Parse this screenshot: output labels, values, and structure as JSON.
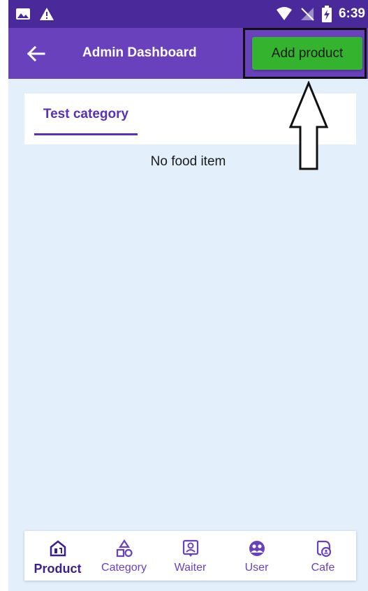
{
  "status_bar": {
    "time": "6:39",
    "icons": [
      "image-icon",
      "warning-icon",
      "wifi-icon",
      "no-sim-icon",
      "battery-charging-icon"
    ]
  },
  "app_bar": {
    "title": "Admin Dashboard",
    "back_icon": "arrow-left-icon",
    "add_button_label": "Add product"
  },
  "tabs": [
    {
      "label": "Test category",
      "selected": true
    }
  ],
  "content": {
    "empty_message": "No food item"
  },
  "bottom_nav": {
    "items": [
      {
        "label": "Product",
        "icon": "store-icon",
        "active": true
      },
      {
        "label": "Category",
        "icon": "shapes-icon",
        "active": false
      },
      {
        "label": "Waiter",
        "icon": "badge-icon",
        "active": false
      },
      {
        "label": "User",
        "icon": "users-icon",
        "active": false
      },
      {
        "label": "Cafe",
        "icon": "cafe-icon",
        "active": false
      }
    ]
  },
  "colors": {
    "status_bar": "#4a2a9a",
    "app_bar": "#6a41bd",
    "add_button": "#33b32e",
    "background": "#e3f0fc",
    "accent": "#5b30b8"
  }
}
